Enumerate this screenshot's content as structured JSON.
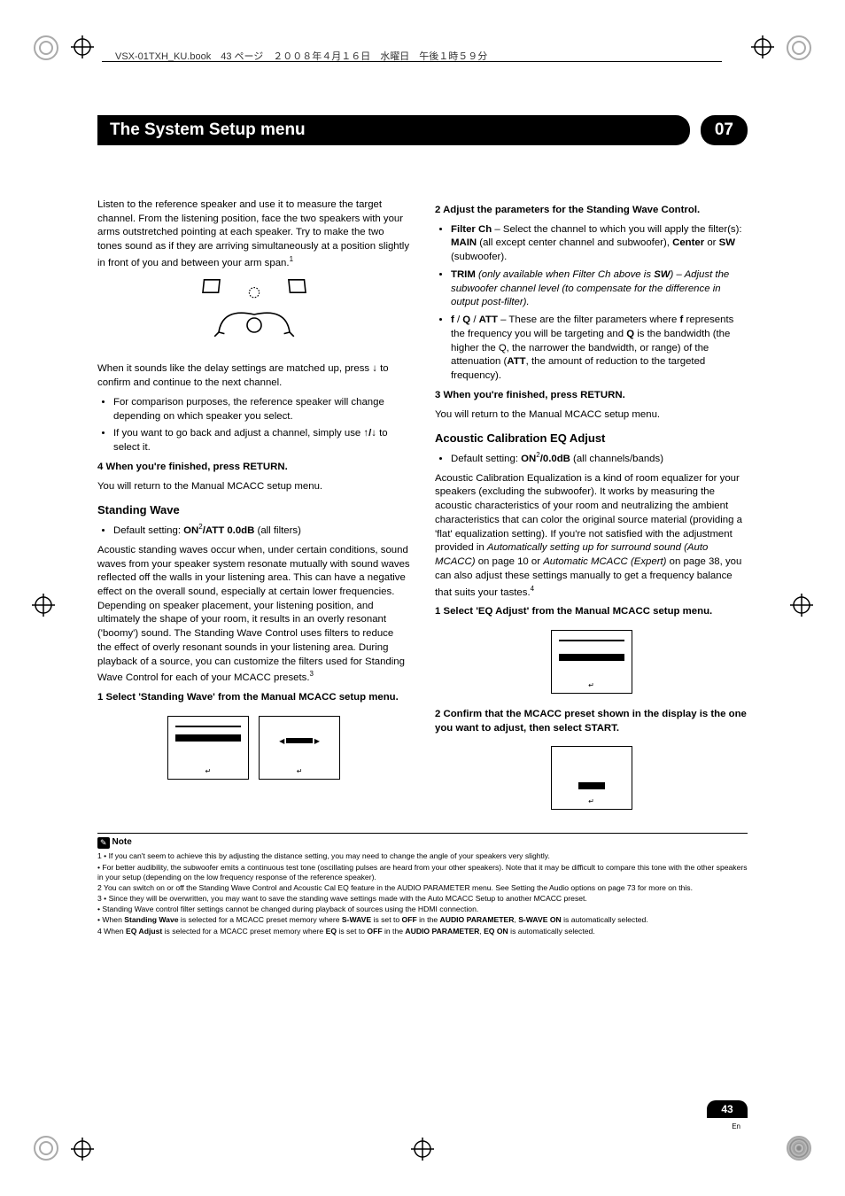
{
  "book_header": "VSX-01TXH_KU.book　43 ページ　２００８年４月１６日　水曜日　午後１時５９分",
  "title": "The System Setup menu",
  "chapter": "07",
  "left": {
    "intro": "Listen to the reference speaker and use it to measure the target channel. From the listening position, face the two speakers with your arms outstretched pointing at each speaker. Try to make the two tones sound as if they are arriving simultaneously at a position slightly in front of you and between your arm span.",
    "intro_sup": "1",
    "after_fig": "When it sounds like the delay settings are matched up, press ",
    "after_fig2": " to confirm and continue to the next channel.",
    "bullet1": "For comparison purposes, the reference speaker will change depending on which speaker you select.",
    "bullet2_a": "If you want to go back and adjust a channel, simply use ",
    "bullet2_b": " to select it.",
    "step4": "4   When you're finished, press RETURN.",
    "step4_body": "You will return to the Manual MCACC setup menu.",
    "standing_wave": "Standing Wave",
    "sw_default_a": "Default setting: ",
    "sw_default_b": "ON",
    "sw_default_sup": "2",
    "sw_default_c": "/ATT 0.0dB",
    "sw_default_d": " (all filters)",
    "sw_body": "Acoustic standing waves occur when, under certain conditions, sound waves from your speaker system resonate mutually with sound waves reflected off the walls in your listening area. This can have a negative effect on the overall sound, especially at certain lower frequencies. Depending on speaker placement, your listening position, and ultimately the shape of your room, it results in an overly resonant ('boomy') sound. The Standing Wave Control uses filters to reduce the effect of overly resonant sounds in your listening area. During playback of a source, you can customize the filters used for Standing Wave Control for each of your MCACC presets.",
    "sw_sup": "3",
    "sw_step1": "1   Select 'Standing Wave' from the Manual MCACC setup menu."
  },
  "right": {
    "step2": "2   Adjust the parameters for the Standing Wave Control.",
    "b1_a": "Filter Ch",
    "b1_b": " – Select the channel to which you will apply the filter(s): ",
    "b1_c": "MAIN",
    "b1_d": " (all except center channel and subwoofer), ",
    "b1_e": "Center",
    "b1_f": " or ",
    "b1_g": "SW",
    "b1_h": " (subwoofer).",
    "b2_a": "TRIM",
    "b2_b": " (only available when Filter Ch above is ",
    "b2_c": "SW",
    "b2_d": ") – Adjust the subwoofer channel level (to compensate for the difference in output post-filter).",
    "b3_a": "f",
    "b3_b": " / ",
    "b3_c": "Q",
    "b3_d": " / ",
    "b3_e": "ATT",
    "b3_f": " – These are the filter parameters where ",
    "b3_g": "f",
    "b3_h": " represents the frequency you will be targeting and ",
    "b3_i": "Q",
    "b3_j": " is the bandwidth (the higher the Q, the narrower the bandwidth, or range) of the attenuation (",
    "b3_k": "ATT",
    "b3_l": ", the amount of reduction to the targeted frequency).",
    "step3": "3   When you're finished, press RETURN.",
    "step3_body": "You will return to the Manual MCACC setup menu.",
    "ac_title": "Acoustic Calibration EQ Adjust",
    "ac_def_a": "Default setting: ",
    "ac_def_b": "ON",
    "ac_def_sup": "2",
    "ac_def_c": "/0.0dB",
    "ac_def_d": " (all channels/bands)",
    "ac_body_a": "Acoustic Calibration Equalization is a kind of room equalizer for your speakers (excluding the subwoofer). It works by measuring the acoustic characteristics of your room and neutralizing the ambient characteristics that can color the original source material (providing a 'flat' equalization setting). If you're not satisfied with the adjustment provided in ",
    "ac_body_b": "Automatically setting up for surround sound (Auto MCACC)",
    "ac_body_c": " on page 10 or ",
    "ac_body_d": "Automatic MCACC (Expert)",
    "ac_body_e": " on page 38, you can also adjust these settings manually to get a frequency balance that suits your tastes.",
    "ac_sup": "4",
    "ac_step1": "1   Select 'EQ Adjust' from the Manual MCACC setup menu.",
    "ac_step2": "2   Confirm that the MCACC preset shown in the display is the one you want to adjust, then select START."
  },
  "note_label": "Note",
  "footnotes": {
    "f1a": "1 • If you can't seem to achieve this by adjusting the distance setting, you may need to change the angle of your speakers very slightly.",
    "f1b": "   • For better audibility, the subwoofer emits a continuous test tone (oscillating pulses are heard from your other speakers). Note that it may be difficult to compare this tone with the other speakers in your setup (depending on the low frequency response of the reference speaker).",
    "f2": "2 You can switch on or off the Standing Wave Control and Acoustic Cal EQ feature in the AUDIO PARAMETER menu. See Setting the Audio options on page 73 for more on this.",
    "f3a": "3 • Since they will be overwritten, you may want to save the standing wave settings made with the Auto MCACC Setup to another MCACC preset.",
    "f3b": "   • Standing Wave control filter settings cannot be changed during playback of sources using the HDMI connection.",
    "f3c_a": "   • When ",
    "f3c_b": "Standing Wave",
    "f3c_c": " is selected for a MCACC preset memory where ",
    "f3c_d": "S-WAVE",
    "f3c_e": " is set to ",
    "f3c_f": "OFF",
    "f3c_g": " in the ",
    "f3c_h": "AUDIO PARAMETER",
    "f3c_i": ", ",
    "f3c_j": "S-WAVE ON",
    "f3c_k": " is automatically selected.",
    "f4_a": "4 When ",
    "f4_b": "EQ Adjust",
    "f4_c": " is selected for a MCACC preset memory where ",
    "f4_d": "EQ",
    "f4_e": " is set to ",
    "f4_f": "OFF",
    "f4_g": " in the ",
    "f4_h": "AUDIO PARAMETER",
    "f4_i": ", ",
    "f4_j": "EQ ON",
    "f4_k": " is automatically selected."
  },
  "page_number": "43",
  "page_lang": "En"
}
